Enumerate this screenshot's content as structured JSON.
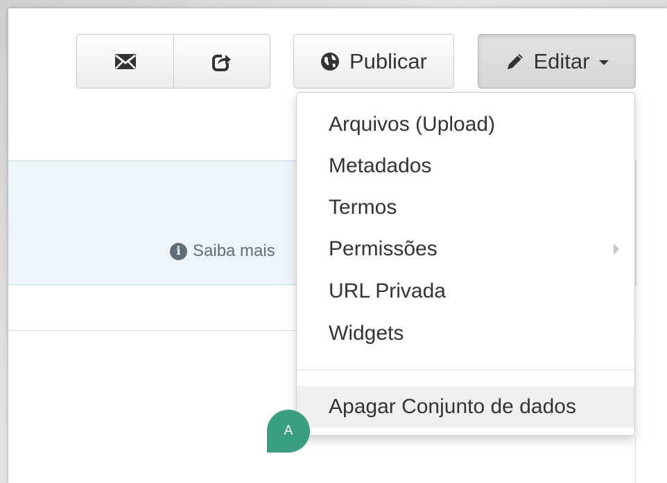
{
  "toolbar": {
    "email_icon": "envelope-icon",
    "share_icon": "share-icon",
    "publish_icon": "globe-icon",
    "publish_label": "Publicar",
    "edit_icon": "pencil-icon",
    "edit_label": "Editar"
  },
  "info": {
    "icon": "info-circle-icon",
    "link_text": "Saiba mais"
  },
  "edit_menu": {
    "items": [
      {
        "label": "Arquivos (Upload)"
      },
      {
        "label": "Metadados"
      },
      {
        "label": "Termos"
      },
      {
        "label": "Permissões",
        "has_submenu": true
      },
      {
        "label": "URL Privada"
      },
      {
        "label": "Widgets"
      }
    ],
    "danger_item": {
      "label": "Apagar Conjunto de dados",
      "highlighted": true
    }
  },
  "annotation": {
    "label": "A",
    "color": "#3a9e83"
  },
  "colors": {
    "info_bg": "#edf5fb",
    "info_border": "#b9dbec",
    "text": "#333333"
  }
}
